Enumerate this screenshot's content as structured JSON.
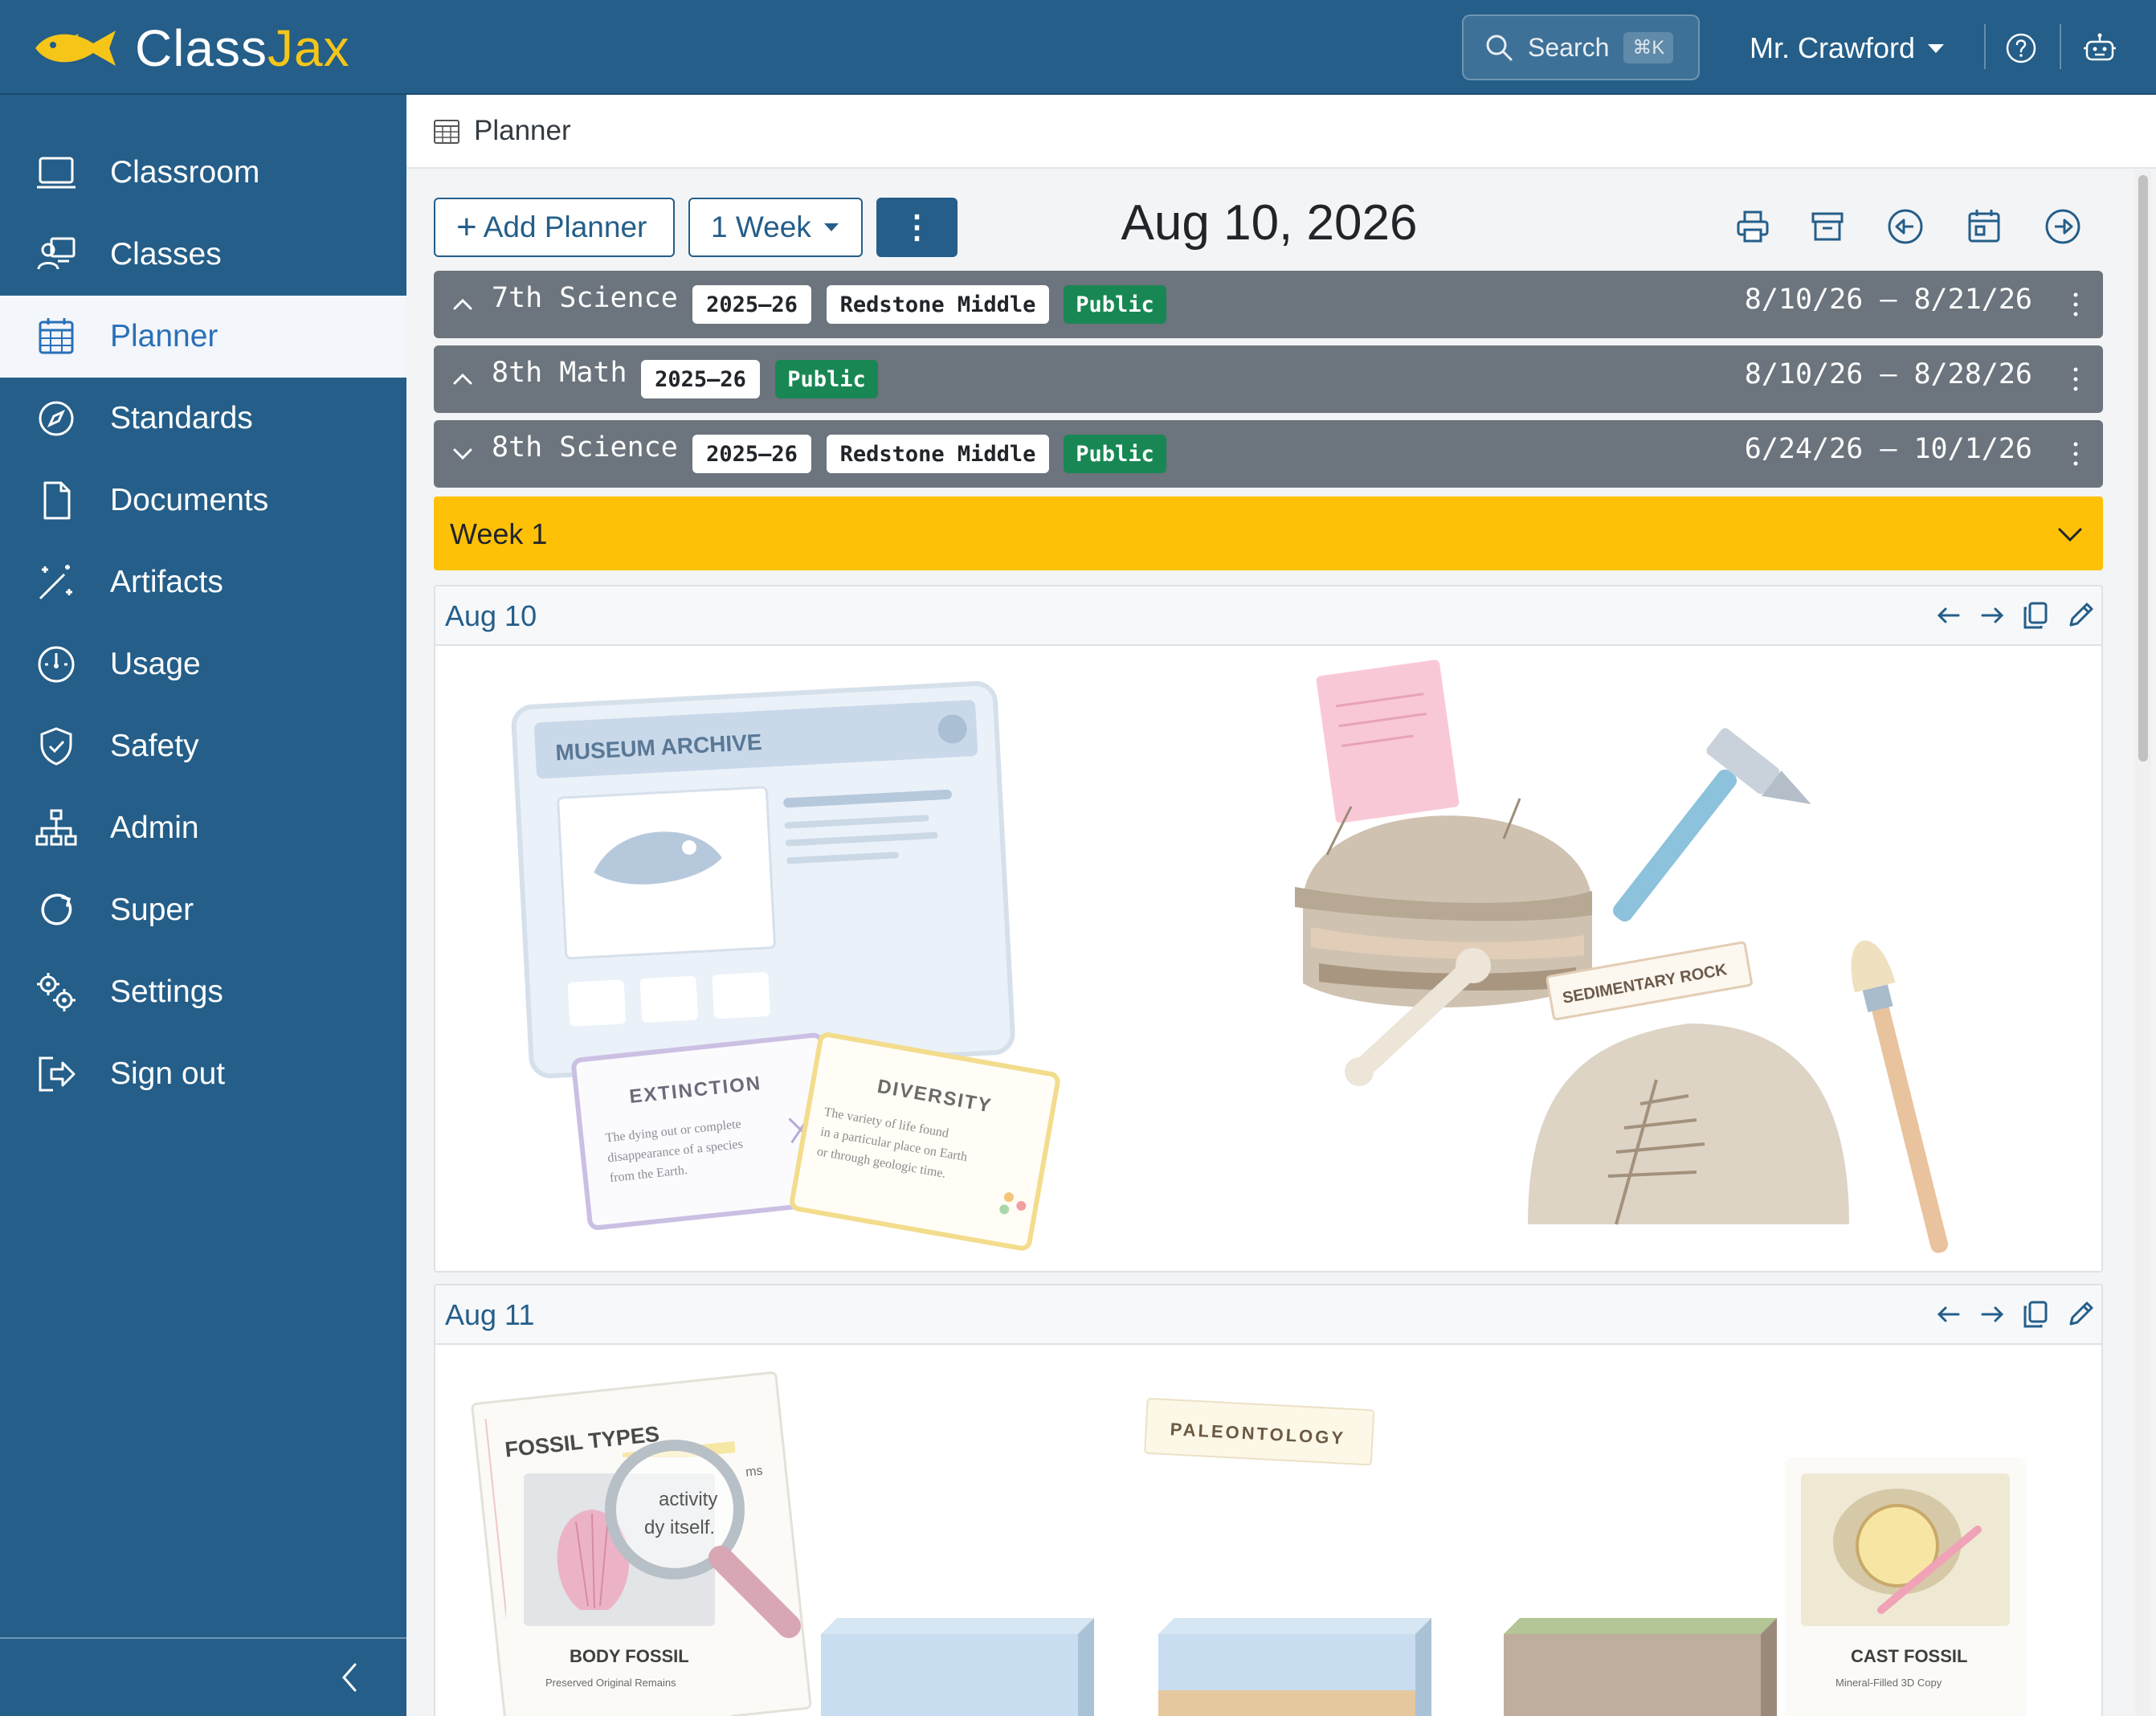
{
  "app": {
    "name_part1": "Class",
    "name_part2": "Jax",
    "brand_color": "#245e89",
    "accent_color": "#f5c518"
  },
  "topbar": {
    "search_label": "Search",
    "search_shortcut": "⌘K",
    "user_name": "Mr. Crawford",
    "icons": [
      "search-icon",
      "help-icon",
      "robot-icon"
    ]
  },
  "sidebar": {
    "items": [
      {
        "label": "Classroom",
        "icon": "monitor-icon"
      },
      {
        "label": "Classes",
        "icon": "teacher-icon"
      },
      {
        "label": "Planner",
        "icon": "calendar-icon",
        "active": true
      },
      {
        "label": "Standards",
        "icon": "compass-icon"
      },
      {
        "label": "Documents",
        "icon": "file-icon"
      },
      {
        "label": "Artifacts",
        "icon": "magic-wand-icon"
      },
      {
        "label": "Usage",
        "icon": "speedometer-icon"
      },
      {
        "label": "Safety",
        "icon": "shield-check-icon"
      },
      {
        "label": "Admin",
        "icon": "org-chart-icon"
      },
      {
        "label": "Super",
        "icon": "loop-icon"
      },
      {
        "label": "Settings",
        "icon": "gears-icon"
      },
      {
        "label": "Sign out",
        "icon": "sign-out-icon"
      }
    ]
  },
  "breadcrumb": {
    "title": "Planner"
  },
  "toolbar": {
    "add_planner": "Add Planner",
    "range_select": "1 Week",
    "more_label": "⋮",
    "current_date": "Aug 10, 2026",
    "icons": [
      "print-icon",
      "archive-icon",
      "rewind-icon",
      "calendar-today-icon",
      "forward-icon"
    ]
  },
  "planners": [
    {
      "name": "7th Science",
      "year": "2025–26",
      "school": "Redstone Middle",
      "visibility": "Public",
      "range": "8/10/26 – 8/21/26",
      "expanded": false
    },
    {
      "name": "8th Math",
      "year": "2025–26",
      "school": "",
      "visibility": "Public",
      "range": "8/10/26 – 8/28/26",
      "expanded": false
    },
    {
      "name": "8th Science",
      "year": "2025–26",
      "school": "Redstone Middle",
      "visibility": "Public",
      "range": "6/24/26 – 10/1/26",
      "expanded": true
    }
  ],
  "week": {
    "label": "Week 1",
    "color": "#ffc107"
  },
  "days": [
    {
      "label": "Aug 10",
      "illustration": {
        "archive_title": "MUSEUM ARCHIVE",
        "card1_title": "EXTINCTION",
        "card1_text": [
          "The dying out or complete",
          "disappearance of a species",
          "from the Earth."
        ],
        "card2_title": "DIVERSITY",
        "card2_text": [
          "The variety of life found",
          "in a particular place on Earth",
          "or through geologic time."
        ],
        "rock_label": "SEDIMENTARY ROCK"
      }
    },
    {
      "label": "Aug 11",
      "illustration": {
        "sheet_title": "FOSSIL TYPES",
        "sheet_fragment1": "ms",
        "lens_text1": "activity",
        "lens_text2": "dy itself.",
        "paleo_label": "PALEONTOLOGY",
        "card1_title": "BODY FOSSIL",
        "card1_sub": "Preserved Original Remains",
        "card2_title": "CAST FOSSIL",
        "card2_sub": "Mineral-Filled 3D Copy"
      }
    }
  ]
}
